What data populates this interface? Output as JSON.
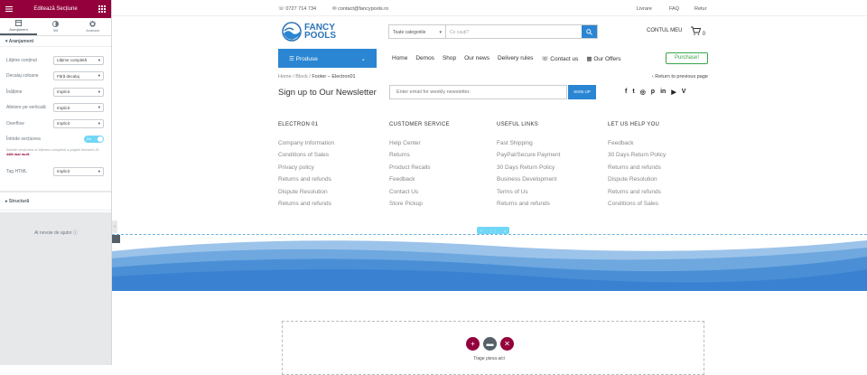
{
  "panel": {
    "title": "Editează Secțiune",
    "tabs": [
      {
        "label": "Aranjament",
        "icon": "layout-icon"
      },
      {
        "label": "Stil",
        "icon": "style-icon"
      },
      {
        "label": "Avansat",
        "icon": "gear-icon"
      }
    ],
    "section_title": "Aranjament",
    "settings": [
      {
        "label": "Lățime conținut",
        "value": "Lățime completă"
      },
      {
        "label": "Decalaj coloane",
        "value": "Fără decalaj"
      },
      {
        "label": "Înălțime",
        "value": "Implicit"
      },
      {
        "label": "Aliniere pe verticală",
        "value": "Implicit"
      },
      {
        "label": "Overflow",
        "value": "Implicit"
      }
    ],
    "stretch_label": "Întinde secțiunea",
    "stretch_toggle": "DA",
    "note": "Întinde secțiunea la lățimea completă a paginii folosind JS.",
    "note_link": "Află mai mult.",
    "html_tag_label": "Tag HTML",
    "html_tag_value": "Implicit",
    "structure_title": "Structură",
    "help": "Ai nevoie de ajutor",
    "accent": "#93003c"
  },
  "site": {
    "phone": "0727 714 734",
    "email": "contact@fancypools.ro",
    "top_links": [
      "Livrare",
      "FAQ",
      "Retur"
    ],
    "logo_line1": "FANCY",
    "logo_line2": "POOLS",
    "search_category": "Toate categoriile",
    "search_placeholder": "Ce cauți?",
    "account": "CONTUL MEU",
    "cart_count": "0",
    "produse": "Produse",
    "nav": [
      "Home",
      "Demos",
      "Shop",
      "Our news",
      "Delivery rules",
      "Contact us",
      "Our Offers"
    ],
    "purchase": "Purchase!",
    "breadcrumb": [
      "Home",
      "Block",
      "Footer – Electron01"
    ],
    "return_link": "Return to previous page",
    "signup_title": "Sign up to Our Newsletter",
    "newsletter_placeholder": "Enter email for weekly newsletter.",
    "signup_button": "SIGN UP",
    "social": [
      "f",
      "t",
      "ig",
      "p",
      "in",
      "yt",
      "v"
    ],
    "columns": [
      {
        "title": "ELECTRON 01",
        "links": [
          "Company Information",
          "Conditions of Sales",
          "Privacy policy",
          "Returns and refunds",
          "Dispute Resolution",
          "Returns and refunds"
        ]
      },
      {
        "title": "CUSTOMER SERVICE",
        "links": [
          "Help Center",
          "Returns",
          "Product Recalls",
          "Feedback",
          "Contact Us",
          "Store Pickup"
        ]
      },
      {
        "title": "USEFUL LINKS",
        "links": [
          "Fast Shipping",
          "PayPal/Secure Payment",
          "30 Days Return Policy",
          "Business Development",
          "Terms of Us",
          "Returns and refunds"
        ]
      },
      {
        "title": "LET US HELP YOU",
        "links": [
          "Feedback",
          "30 Days Return Policy",
          "Returns and refunds",
          "Dispute Resolution",
          "Returns and refunds",
          "Conditions of Sales"
        ]
      }
    ],
    "drop_text": "Trage piesa aici",
    "brand_blue": "#2a86d3"
  }
}
